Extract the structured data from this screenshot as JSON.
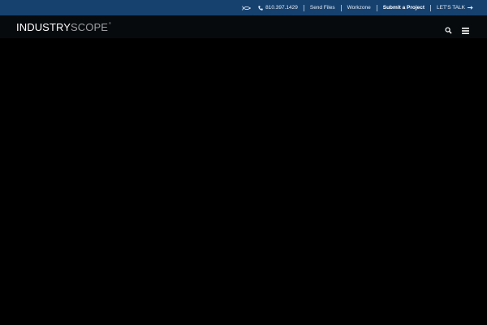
{
  "topbar": {
    "phone": "810.397.1429",
    "send_files": "Send Files",
    "workzone": "Workzone",
    "submit": "Submit a Project",
    "lets_talk": "LET'S TALK"
  },
  "header": {
    "logo_part1": "INDUSTRY",
    "logo_part2": "SCOPE",
    "logo_mark": "®"
  },
  "colors": {
    "topbar_bg": "#16416f",
    "header_bg": "#070a0d",
    "page_bg": "#000000"
  },
  "icons": [
    "ichthys-fish-icon",
    "phone-icon",
    "arrow-right-icon",
    "search-icon",
    "hamburger-menu-icon"
  ]
}
